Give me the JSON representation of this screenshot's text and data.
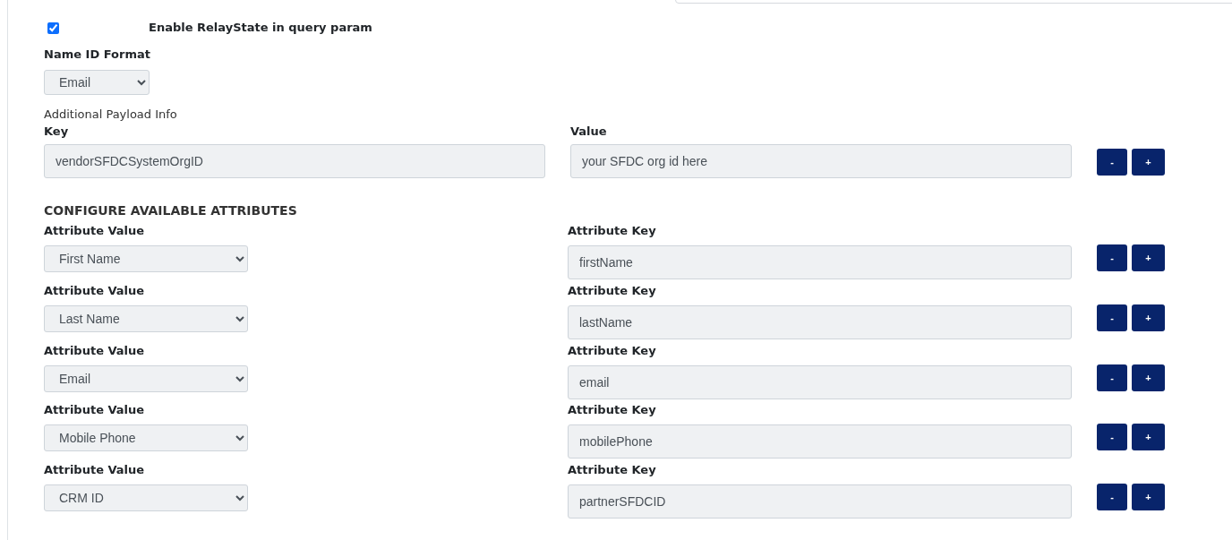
{
  "relay_state": {
    "label": "Enable RelayState in query param",
    "checked": true
  },
  "name_id_format": {
    "label": "Name ID Format",
    "value": "Email"
  },
  "payload": {
    "title": "Additional Payload Info",
    "key_label": "Key",
    "value_label": "Value",
    "rows": [
      {
        "key": "vendorSFDCSystemOrgID",
        "value": "your SFDC org id here",
        "remove": "-",
        "add": "+"
      }
    ]
  },
  "attributes": {
    "heading": "CONFIGURE AVAILABLE ATTRIBUTES",
    "rows": [
      {
        "value_label": "Attribute Value",
        "value": "First Name",
        "key_label": "Attribute Key",
        "key": "firstName",
        "remove": "-",
        "add": "+"
      },
      {
        "value_label": "Attribute Value",
        "value": "Last Name",
        "key_label": "Attribute Key",
        "key": "lastName",
        "remove": "-",
        "add": "+"
      },
      {
        "value_label": "Attribute Value",
        "value": "Email",
        "key_label": "Attribute Key",
        "key": "email",
        "remove": "-",
        "add": "+"
      },
      {
        "value_label": "Attribute Value",
        "value": "Mobile Phone",
        "key_label": "Attribute Key",
        "key": "mobilePhone",
        "remove": "-",
        "add": "+"
      },
      {
        "value_label": "Attribute Value",
        "value": "CRM ID",
        "key_label": "Attribute Key",
        "key": "partnerSFDCID",
        "remove": "-",
        "add": "+"
      }
    ]
  }
}
